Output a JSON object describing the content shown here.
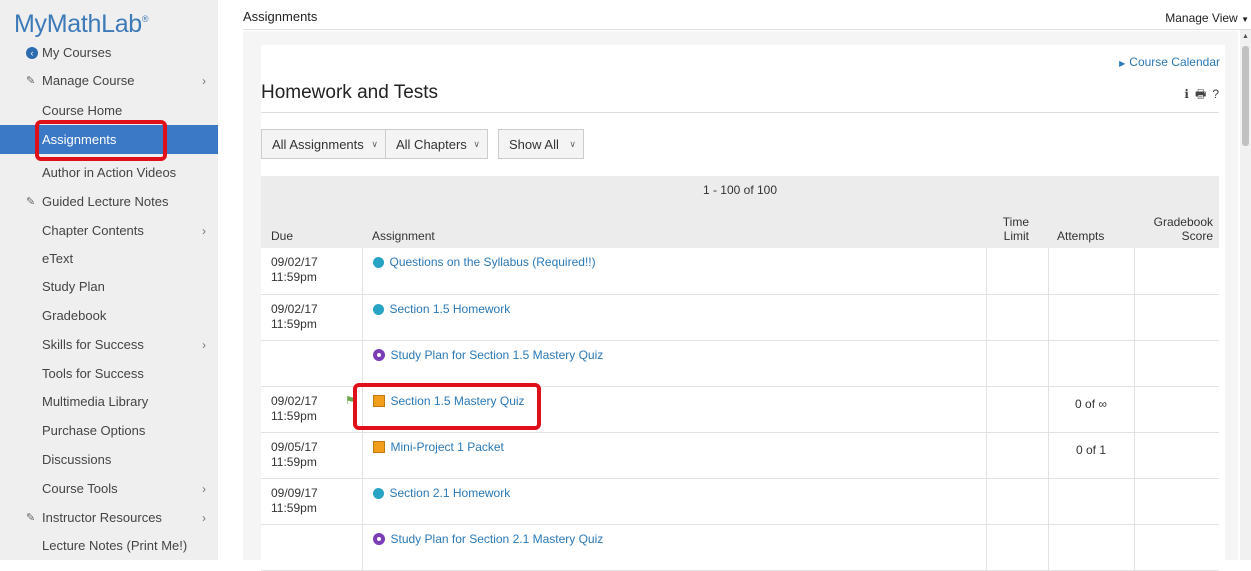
{
  "brand": {
    "name": "MyMathLab",
    "mark": "®"
  },
  "sidebar": {
    "items": [
      {
        "label": "My Courses",
        "icon": "back-circle-icon",
        "chevron": false
      },
      {
        "label": "Manage Course",
        "icon": "manage-icon",
        "chevron": true
      },
      {
        "label": "Course Home",
        "icon": "",
        "chevron": false
      },
      {
        "label": "Assignments",
        "icon": "",
        "chevron": false,
        "active": true
      },
      {
        "label": "Author in Action Videos",
        "icon": "",
        "chevron": false
      },
      {
        "label": "Guided Lecture Notes",
        "icon": "manage-icon",
        "chevron": false
      },
      {
        "label": "Chapter Contents",
        "icon": "",
        "chevron": true
      },
      {
        "label": "eText",
        "icon": "",
        "chevron": false
      },
      {
        "label": "Study Plan",
        "icon": "",
        "chevron": false
      },
      {
        "label": "Gradebook",
        "icon": "",
        "chevron": false
      },
      {
        "label": "Skills for Success",
        "icon": "",
        "chevron": true
      },
      {
        "label": "Tools for Success",
        "icon": "",
        "chevron": false
      },
      {
        "label": "Multimedia Library",
        "icon": "",
        "chevron": false
      },
      {
        "label": "Purchase Options",
        "icon": "",
        "chevron": false
      },
      {
        "label": "Discussions",
        "icon": "",
        "chevron": false
      },
      {
        "label": "Course Tools",
        "icon": "",
        "chevron": true
      },
      {
        "label": "Instructor Resources",
        "icon": "manage-icon",
        "chevron": true
      },
      {
        "label": "Lecture Notes (Print Me!)",
        "icon": "",
        "chevron": false
      }
    ]
  },
  "header": {
    "title": "Assignments",
    "manage_view": "Manage View"
  },
  "main": {
    "course_calendar": "Course Calendar",
    "section_title": "Homework and Tests",
    "filters": {
      "type": "All Assignments",
      "chapters": "All Chapters",
      "show": "Show All"
    },
    "pager": "1 - 100 of 100",
    "columns": {
      "due": "Due",
      "assignment": "Assignment",
      "time_limit_1": "Time",
      "time_limit_2": "Limit",
      "attempts": "Attempts",
      "gradebook_1": "Gradebook",
      "gradebook_2": "Score"
    },
    "rows": [
      {
        "due_date": "09/02/17",
        "due_time": "11:59pm",
        "name": "Questions on the Syllabus (Required!!)",
        "kind": "homework",
        "attempts": "",
        "flag": false
      },
      {
        "due_date": "09/02/17",
        "due_time": "11:59pm",
        "name": "Section 1.5 Homework",
        "kind": "homework",
        "attempts": "",
        "flag": false
      },
      {
        "due_date": "",
        "due_time": "",
        "name": "Study Plan for Section 1.5 Mastery Quiz",
        "kind": "studyplan",
        "attempts": "",
        "flag": false
      },
      {
        "due_date": "09/02/17",
        "due_time": "11:59pm",
        "name": "Section 1.5 Mastery Quiz",
        "kind": "quiz",
        "attempts": "0 of ∞",
        "flag": true
      },
      {
        "due_date": "09/05/17",
        "due_time": "11:59pm",
        "name": "Mini-Project 1 Packet",
        "kind": "quiz",
        "attempts": "0 of 1",
        "flag": false
      },
      {
        "due_date": "09/09/17",
        "due_time": "11:59pm",
        "name": "Section 2.1 Homework",
        "kind": "homework",
        "attempts": "",
        "flag": false
      },
      {
        "due_date": "",
        "due_time": "",
        "name": "Study Plan for Section 2.1 Mastery Quiz",
        "kind": "studyplan",
        "attempts": "",
        "flag": false
      }
    ]
  },
  "colors": {
    "accent": "#3b78c5",
    "link": "#2a78b5",
    "highlight": "#e0101b"
  }
}
